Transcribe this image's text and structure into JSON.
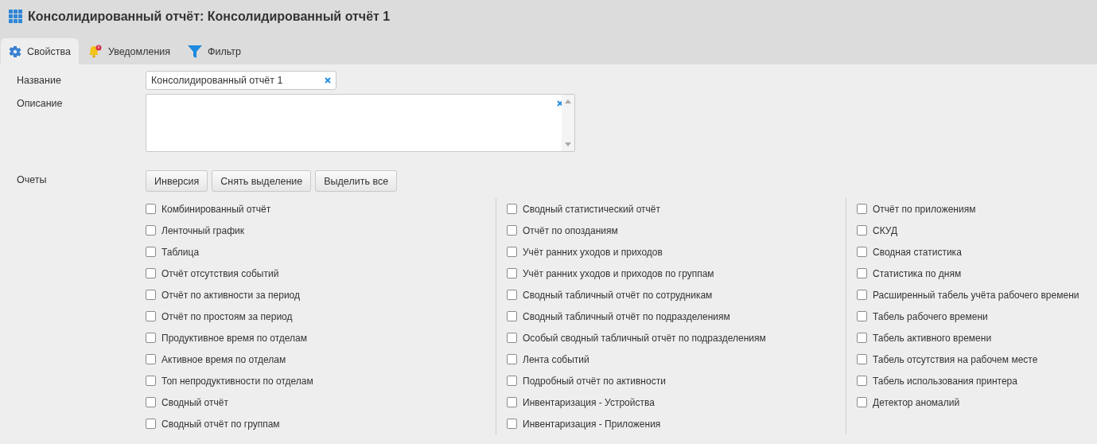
{
  "window": {
    "title": "Консолидированный отчёт: Консолидированный отчёт 1"
  },
  "tabs": [
    {
      "label": "Свойства",
      "selected": true,
      "kind": "properties"
    },
    {
      "label": "Уведомления",
      "selected": false,
      "kind": "notifications"
    },
    {
      "label": "Фильтр",
      "selected": false,
      "kind": "filter"
    }
  ],
  "name_field": {
    "label": "Название",
    "value": "Консолидированный отчёт 1"
  },
  "description_field": {
    "label": "Описание"
  },
  "reports": {
    "label": "Очеты",
    "buttons": [
      "Инверсия",
      "Снять выделение",
      "Выделить все"
    ],
    "columns": [
      [
        {
          "label": "Комбинированный отчёт",
          "checked": false
        },
        {
          "label": "Ленточный график",
          "checked": false
        },
        {
          "label": "Таблица",
          "checked": false
        },
        {
          "label": "Отчёт отсутствия событий",
          "checked": false
        },
        {
          "label": "Отчёт по активности за период",
          "checked": false
        },
        {
          "label": "Отчёт по простоям за период",
          "checked": false
        },
        {
          "label": "Продуктивное время по отделам",
          "checked": false
        },
        {
          "label": "Активное время по отделам",
          "checked": false
        },
        {
          "label": "Топ непродуктивности по отделам",
          "checked": false
        },
        {
          "label": "Сводный отчёт",
          "checked": false
        },
        {
          "label": "Сводный отчёт по группам",
          "checked": false
        }
      ],
      [
        {
          "label": "Сводный статистический отчёт",
          "checked": false
        },
        {
          "label": "Отчёт по опозданиям",
          "checked": false
        },
        {
          "label": "Учёт ранних уходов и приходов",
          "checked": false
        },
        {
          "label": "Учёт ранних уходов и приходов по группам",
          "checked": false
        },
        {
          "label": "Сводный табличный отчёт по сотрудникам",
          "checked": false
        },
        {
          "label": "Сводный табличный отчёт по подразделениям",
          "checked": false
        },
        {
          "label": "Особый сводный табличный отчёт по подразделениям",
          "checked": false
        },
        {
          "label": "Лента событий",
          "checked": false
        },
        {
          "label": "Подробный отчёт по активности",
          "checked": false
        },
        {
          "label": "Инвентаризация - Устройства",
          "checked": false
        },
        {
          "label": "Инвентаризация - Приложения",
          "checked": false
        }
      ],
      [
        {
          "label": "Отчёт по приложениям",
          "checked": false
        },
        {
          "label": "СКУД",
          "checked": false
        },
        {
          "label": "Сводная статистика",
          "checked": false
        },
        {
          "label": "Статистика по дням",
          "checked": false
        },
        {
          "label": "Расширенный табель учёта рабочего времени",
          "checked": false
        },
        {
          "label": "Табель рабочего времени",
          "checked": false
        },
        {
          "label": "Табель активного времени",
          "checked": false
        },
        {
          "label": "Табель отсутствия на рабочем месте",
          "checked": false
        },
        {
          "label": "Табель использования принтера",
          "checked": false
        },
        {
          "label": "Детектор аномалий",
          "checked": false
        }
      ]
    ]
  }
}
